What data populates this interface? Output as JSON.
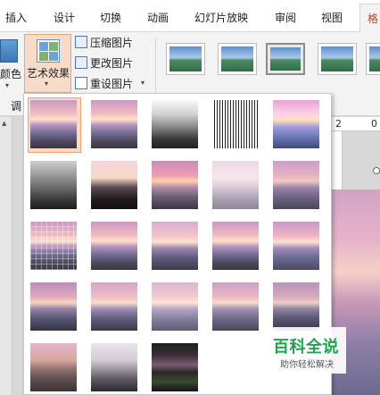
{
  "tabs": [
    {
      "label": "插入"
    },
    {
      "label": "设计"
    },
    {
      "label": "切换"
    },
    {
      "label": "动画"
    },
    {
      "label": "幻灯片放映"
    },
    {
      "label": "审阅"
    },
    {
      "label": "视图"
    },
    {
      "label": "格"
    }
  ],
  "ribbon": {
    "color_label": "颜色",
    "artistic_effects_label": "艺术效果",
    "compress_label": "压缩图片",
    "change_label": "更改图片",
    "reset_label": "重设图片",
    "adjust_group_label": "调"
  },
  "ruler": {
    "mark_2": "2",
    "mark_0": "0"
  },
  "gallery": {
    "rows": 5,
    "columns": 5,
    "filled_count": 23,
    "selected_index": 0
  },
  "watermark": {
    "title": "百科全说",
    "subtitle": "助你轻松解决"
  },
  "colors": {
    "accent": "#b7472a",
    "selection_fill": "#f8d9c3",
    "selection_border": "#eaa575",
    "watermark_green": "#1ea551"
  }
}
